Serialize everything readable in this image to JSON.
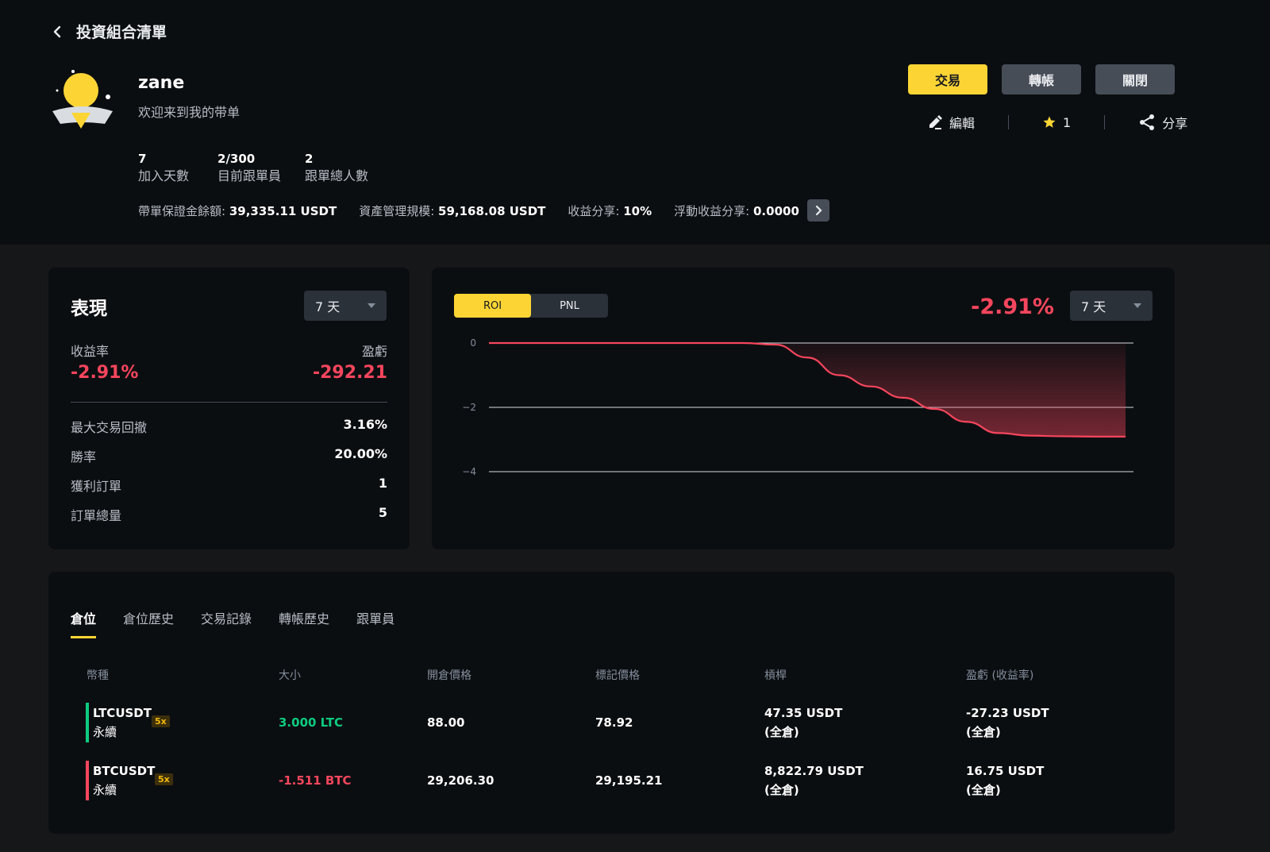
{
  "header": {
    "back_title": "投資組合清單",
    "username": "zane",
    "bio": "欢迎来到我的带单",
    "stats": [
      {
        "value": "7",
        "label": "加入天數"
      },
      {
        "value": "2/300",
        "label": "目前跟單員"
      },
      {
        "value": "2",
        "label": "跟單總人數"
      }
    ],
    "info": [
      {
        "key": "帶單保證金餘額:",
        "value": "39,335.11 USDT"
      },
      {
        "key": "資產管理規模:",
        "value": "59,168.08 USDT"
      },
      {
        "key": "收益分享:",
        "value": "10%"
      },
      {
        "key": "浮動收益分享:",
        "value": "0.0000"
      }
    ],
    "buttons": {
      "trade": "交易",
      "transfer": "轉帳",
      "close": "關閉"
    },
    "actions": {
      "edit": "編輯",
      "favorite_count": "1",
      "share": "分享"
    }
  },
  "performance": {
    "title": "表現",
    "period": "7 天",
    "roi_label": "收益率",
    "pnl_label": "盈虧",
    "roi_value": "-2.91%",
    "pnl_value": "-292.21",
    "metrics": [
      {
        "label": "最大交易回撤",
        "value": "3.16%"
      },
      {
        "label": "勝率",
        "value": "20.00%"
      },
      {
        "label": "獲利訂單",
        "value": "1"
      },
      {
        "label": "訂單總量",
        "value": "5"
      }
    ]
  },
  "chart_panel": {
    "toggle_on": "ROI",
    "toggle_off": "PNL",
    "roi_big": "-2.91%",
    "period": "7 天"
  },
  "chart_data": {
    "type": "area",
    "ylim": [
      -4,
      0
    ],
    "yticks": [
      "0",
      "−2",
      "−4"
    ],
    "ytick_values": [
      0,
      -2,
      -4
    ],
    "x": [
      0,
      1,
      2,
      3,
      4,
      5,
      6,
      7,
      8,
      9,
      10,
      11,
      12,
      13,
      14,
      15,
      16,
      17,
      18,
      19,
      20
    ],
    "series": [
      {
        "values": [
          0,
          0,
          0,
          0,
          0,
          0,
          0,
          0,
          0,
          -0.05,
          -0.45,
          -1.0,
          -1.35,
          -1.7,
          -2.05,
          -2.45,
          -2.8,
          -2.88,
          -2.9,
          -2.91,
          -2.91
        ]
      }
    ],
    "colors": {
      "line": "#f6465d",
      "grid": "#d9dce0"
    }
  },
  "positions": {
    "tabs": [
      "倉位",
      "倉位歷史",
      "交易記錄",
      "轉帳歷史",
      "跟單員"
    ],
    "columns": [
      "幣種",
      "大小",
      "開倉價格",
      "標記價格",
      "槓桿",
      "盈虧 (收益率)"
    ],
    "rows": [
      {
        "symbol": "LTCUSDT",
        "type": "永續",
        "leverage": "5x",
        "size": "3.000 LTC",
        "entry": "88.00",
        "mark": "78.92",
        "margin": "47.35 USDT",
        "margin_mode": "(全倉)",
        "pnl": "-27.23 USDT",
        "pnl_mode": "(全倉)",
        "side_color": "#0ecb81"
      },
      {
        "symbol": "BTCUSDT",
        "type": "永續",
        "leverage": "5x",
        "size": "-1.511 BTC",
        "entry": "29,206.30",
        "mark": "29,195.21",
        "margin": "8,822.79 USDT",
        "margin_mode": "(全倉)",
        "pnl": "16.75 USDT",
        "pnl_mode": "(全倉)",
        "side_color": "#f6465d"
      }
    ]
  }
}
